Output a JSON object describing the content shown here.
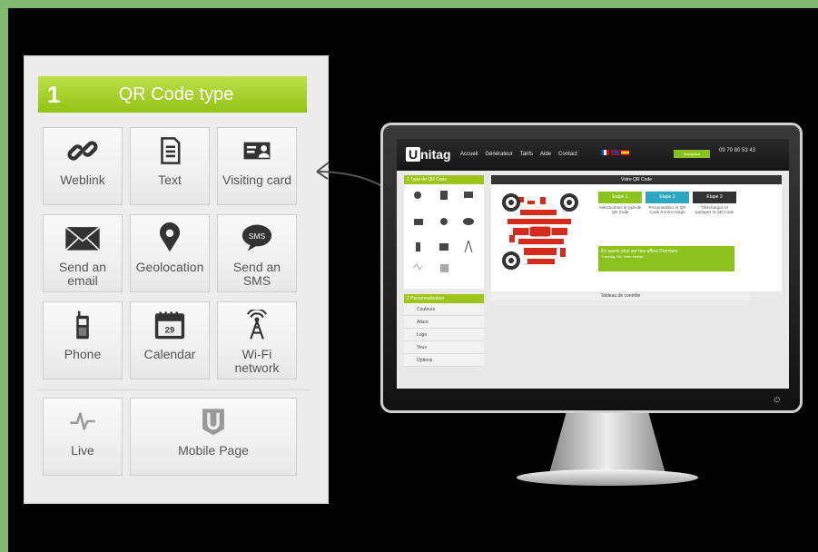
{
  "panel": {
    "step_number": "1",
    "title": "QR Code type",
    "tiles": [
      {
        "label": "Weblink",
        "icon": "link-icon"
      },
      {
        "label": "Text",
        "icon": "document-icon"
      },
      {
        "label": "Visiting card",
        "icon": "business-card-icon"
      },
      {
        "label": "Send an email",
        "icon": "envelope-icon"
      },
      {
        "label": "Geolocation",
        "icon": "map-pin-icon"
      },
      {
        "label": "Send an SMS",
        "icon": "sms-bubble-icon"
      },
      {
        "label": "Phone",
        "icon": "mobile-phone-icon"
      },
      {
        "label": "Calendar",
        "icon": "calendar-icon"
      },
      {
        "label": "Wi-Fi network",
        "icon": "wifi-antenna-icon"
      },
      {
        "label": "Live",
        "icon": "pulse-icon"
      },
      {
        "label": "Mobile Page",
        "icon": "unitag-shield-icon"
      }
    ],
    "sms_icon_text": "SMS",
    "calendar_icon_day": "29"
  },
  "monitor": {
    "logo": "nitag",
    "logo_letter": "U",
    "nav": [
      "Accueil",
      "Générateur",
      "Tarifs",
      "Aide",
      "Contact"
    ],
    "button": "Inscription",
    "phone": "09 70 80 53 43",
    "left_header": "1  Type de QR Code",
    "left_header_2": "2  Personnalisation",
    "custom_items": [
      "Couleurs",
      "Allure",
      "Logo",
      "Yeux",
      "Options"
    ],
    "right_header": "Votre QR Code",
    "steps": [
      {
        "title": "Etape 1",
        "text": "Sélectionnez le type de QR Code",
        "color": "#8cc21e"
      },
      {
        "title": "Etape 2",
        "text": "Personnalisez le QR Code à votre image",
        "color": "#2fa6bf"
      },
      {
        "title": "Etape 3",
        "text": "Téléchargez et partagez le QR Code",
        "color": "#333333"
      }
    ],
    "promo": "En savoir plus sur nos offres Premium",
    "promo_sub": "Tracking, HD, Web Mobile...",
    "table_title": "Tableau de contrôle"
  }
}
